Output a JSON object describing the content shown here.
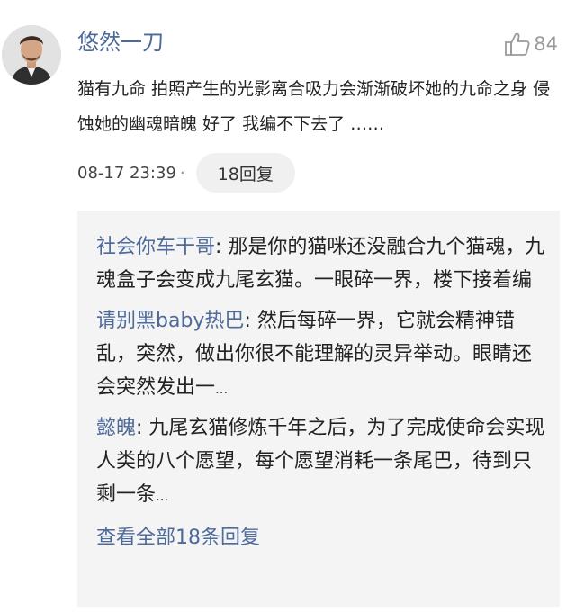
{
  "comment": {
    "username": "悠然一刀",
    "like_count": "84",
    "text": "猫有九命 拍照产生的光影离合吸力会渐渐破坏她的九命之身 侵蚀她的幽魂暗魄 好了 我编不下去了 ……",
    "timestamp": "08-17 23:39",
    "separator": "·",
    "reply_count_label": "18回复"
  },
  "replies": [
    {
      "author": "社会你车干哥",
      "colon": ":",
      "text": " 那是你的猫咪还没融合九个猫魂，九魂盒子会变成九尾玄猫。一眼碎一界，楼下接着编",
      "ellipsis": ""
    },
    {
      "author": "请别黑baby热巴",
      "colon": ":",
      "text": " 然后每碎一界，它就会精神错乱，突然，做出你很不能理解的灵异举动。眼睛还会突然发出一",
      "ellipsis": "..."
    },
    {
      "author": "懿魄",
      "colon": ":",
      "text": " 九尾玄猫修炼千年之后，为了完成使命会实现人类的八个愿望，每个愿望消耗一条尾巴，待到只剩一条",
      "ellipsis": "..."
    }
  ],
  "view_all_label": "查看全部18条回复",
  "icons": {
    "like": "thumbs-up-icon",
    "avatar": "user-avatar"
  },
  "colors": {
    "link": "#4e6a9a",
    "text": "#222222",
    "muted": "#9a9a9a",
    "reply_bg": "#f4f4f4",
    "chip_bg": "#f0f0f0"
  }
}
